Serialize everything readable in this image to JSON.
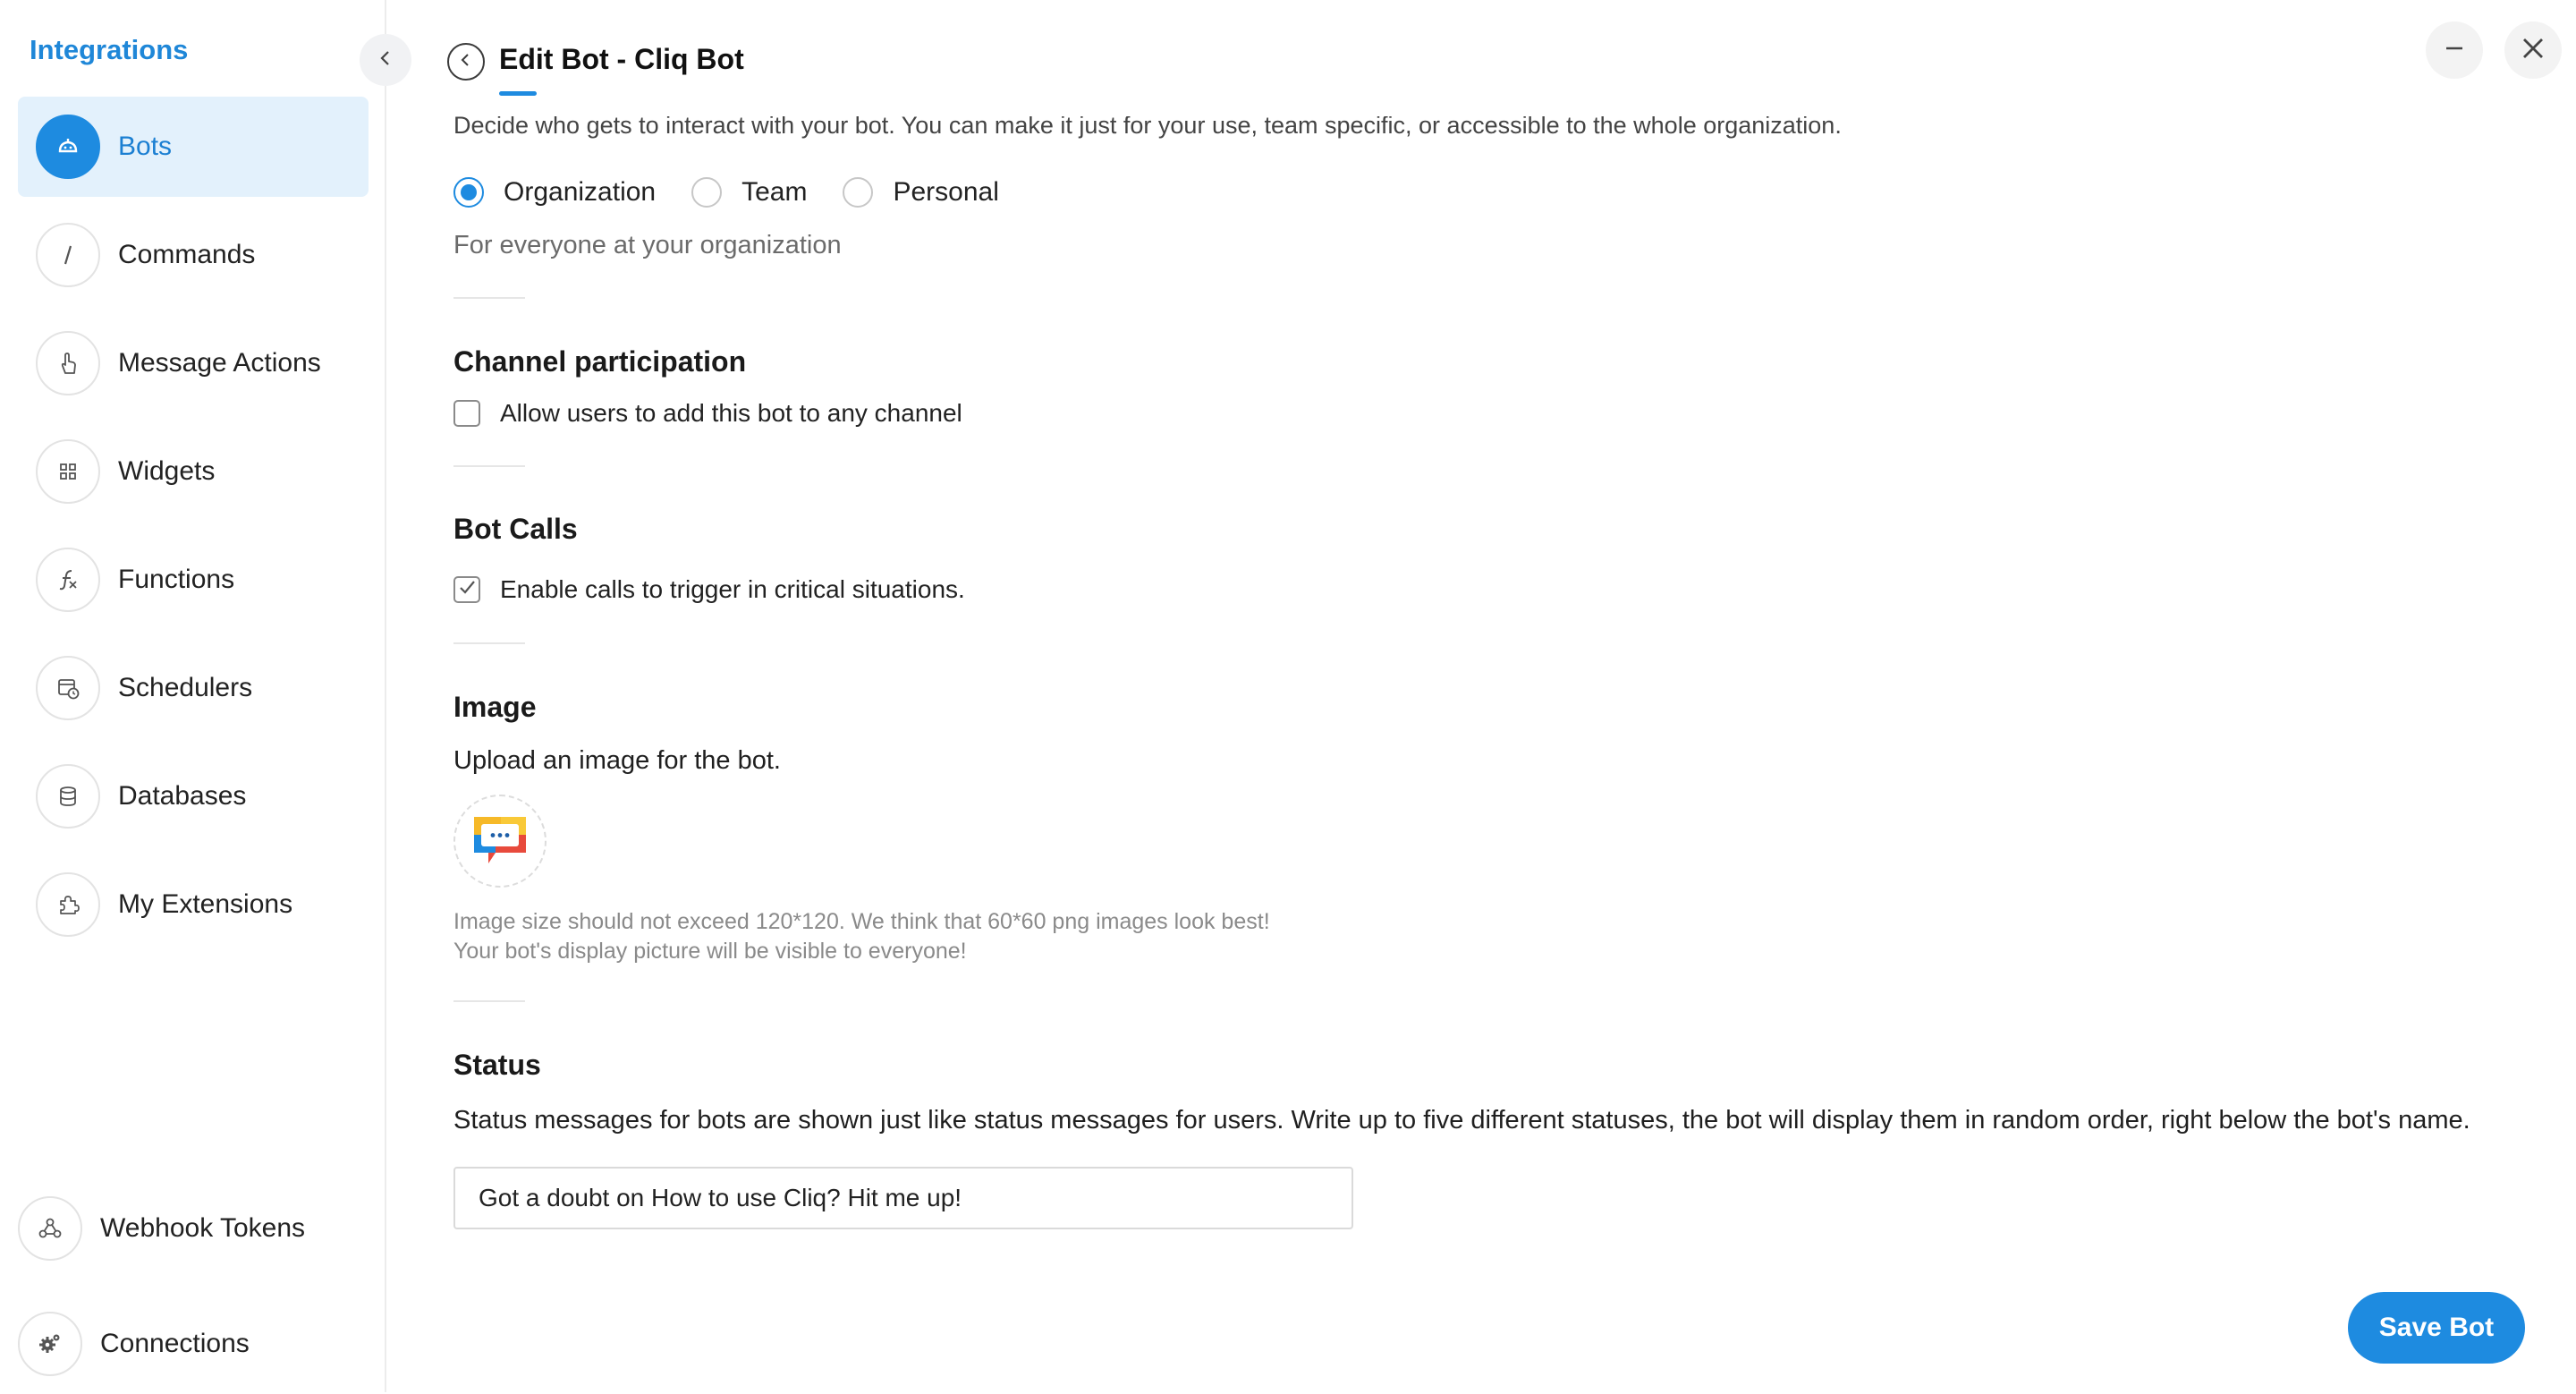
{
  "sidebar": {
    "title": "Integrations",
    "items": [
      {
        "label": "Bots",
        "icon": "bot-icon",
        "active": true
      },
      {
        "label": "Commands",
        "icon": "slash-icon"
      },
      {
        "label": "Message Actions",
        "icon": "hand-pointer-icon"
      },
      {
        "label": "Widgets",
        "icon": "grid-icon"
      },
      {
        "label": "Functions",
        "icon": "function-icon"
      },
      {
        "label": "Schedulers",
        "icon": "calendar-clock-icon"
      },
      {
        "label": "Databases",
        "icon": "database-icon"
      },
      {
        "label": "My Extensions",
        "icon": "puzzle-icon"
      }
    ],
    "bottom_items": [
      {
        "label": "Webhook Tokens",
        "icon": "webhook-icon"
      },
      {
        "label": "Connections",
        "icon": "gears-icon"
      }
    ]
  },
  "header": {
    "title": "Edit Bot - Cliq Bot"
  },
  "access": {
    "description": "Decide who gets to interact with your bot. You can make it just for your use, team specific, or accessible to the whole organization.",
    "options": [
      "Organization",
      "Team",
      "Personal"
    ],
    "selected": "Organization",
    "helper": "For everyone at your organization"
  },
  "channel": {
    "title": "Channel participation",
    "checkbox_label": "Allow users to add this bot to any channel",
    "checked": false
  },
  "calls": {
    "title": "Bot Calls",
    "checkbox_label": "Enable calls to trigger in critical situations.",
    "checked": true
  },
  "image": {
    "title": "Image",
    "description": "Upload an image for the bot.",
    "note_1": "Image size should not exceed 120*120. We think that 60*60 png images look best!",
    "note_2": "Your bot's display picture will be visible to everyone!"
  },
  "status": {
    "title": "Status",
    "description": "Status messages for bots are shown just like status messages for users. Write up to five different statuses, the bot will display them in random order, right below the bot's name.",
    "input_value": "Got a doubt on How to use Cliq? Hit me up!"
  },
  "actions": {
    "save_label": "Save Bot"
  },
  "colors": {
    "accent": "#1e8be0",
    "active_bg": "#e3f1fc",
    "sidebar_title": "#1f87d8"
  }
}
